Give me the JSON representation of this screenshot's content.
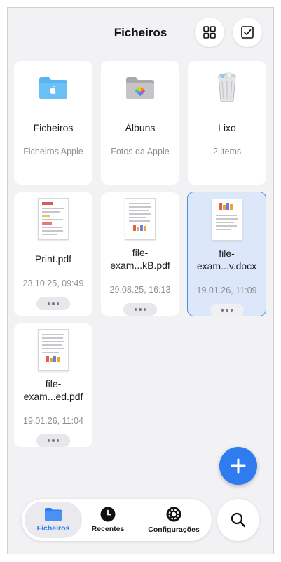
{
  "header": {
    "title": "Ficheiros"
  },
  "locations": [
    {
      "name": "Ficheiros",
      "subtitle": "Ficheiros Apple",
      "icon": "folder-apple-icon"
    },
    {
      "name": "Álbuns",
      "subtitle": "Fotos da Apple",
      "icon": "photos-folder-icon"
    },
    {
      "name": "Lixo",
      "subtitle": "2 items",
      "icon": "trash-icon"
    }
  ],
  "files": [
    {
      "name": "Print.pdf",
      "date": "23.10.25, 09:49",
      "icon": "pdf-thumbnail-icon"
    },
    {
      "name_line1": "file-",
      "name_line2": "exam...kB.pdf",
      "date": "29.08.25, 16:13",
      "icon": "pdf-thumbnail-icon"
    },
    {
      "name_line1": "file-",
      "name_line2": "exam...v.docx",
      "date": "19.01.26, 11:09",
      "icon": "docx-thumbnail-icon",
      "selected": true
    },
    {
      "name_line1": "file-",
      "name_line2": "exam...ed.pdf",
      "date": "19.01.26, 11:04",
      "icon": "pdf-thumbnail-icon"
    }
  ],
  "tabs": [
    {
      "label": "Ficheiros",
      "icon": "folder-icon",
      "active": true
    },
    {
      "label": "Recentes",
      "icon": "clock-icon"
    },
    {
      "label": "Configurações",
      "icon": "gear-icon"
    }
  ],
  "colors": {
    "accent": "#2f7cf0",
    "selected_bg": "#dce8fa",
    "background": "#f2f2f4"
  }
}
